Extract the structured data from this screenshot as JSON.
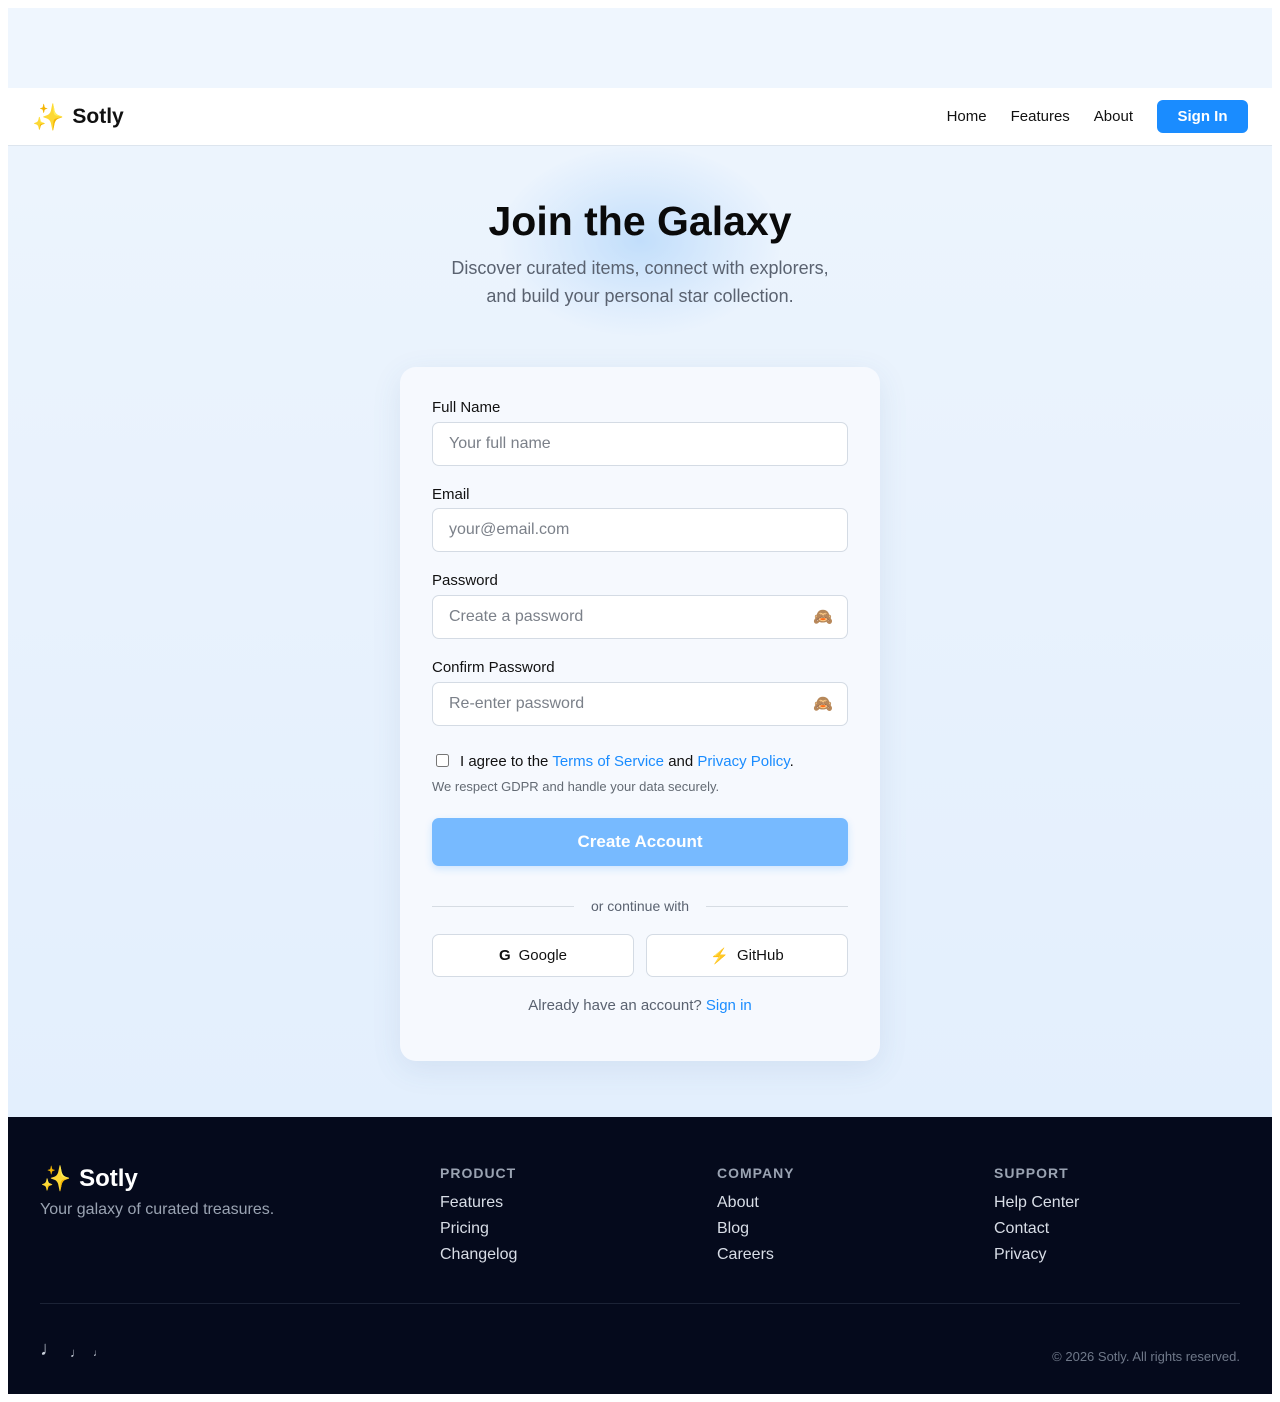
{
  "header": {
    "brand_icon": "sparkles-icon",
    "brand_icon_glyph": "✨",
    "brand_name": "Sotly",
    "nav": [
      "Home",
      "Features",
      "About"
    ],
    "signin_label": "Sign In",
    "accent_color": "#1a8cff"
  },
  "hero": {
    "title": "Join the Galaxy",
    "subtitle": "Discover curated items, connect with explorers, and build your personal star collection."
  },
  "form": {
    "full_name": {
      "label": "Full Name",
      "placeholder": "Your full name",
      "value": ""
    },
    "email": {
      "label": "Email",
      "placeholder": "your@email.com",
      "value": ""
    },
    "password": {
      "label": "Password",
      "placeholder": "Create a password",
      "value": "",
      "toggle_icon": "see-no-evil-monkey-icon",
      "toggle_glyph": "🙈"
    },
    "confirm_password": {
      "label": "Confirm Password",
      "placeholder": "Re-enter password",
      "value": "",
      "toggle_icon": "see-no-evil-monkey-icon",
      "toggle_glyph": "🙈"
    },
    "terms": {
      "checked": false,
      "prefix": "I agree to the",
      "tos_link": "Terms of Service",
      "middle": "and",
      "privacy_link": "Privacy Policy",
      "suffix": "."
    },
    "gdpr_note": "We respect GDPR and handle your data securely.",
    "submit_label": "Create Account",
    "submit_color": "#77baff",
    "divider_text": "or continue with",
    "social": {
      "google": {
        "icon": "google-icon",
        "glyph": "G",
        "label": "Google"
      },
      "github": {
        "icon": "lightning-icon",
        "glyph": "⚡",
        "label": "GitHub"
      }
    },
    "signin_prompt": "Already have an account?",
    "signin_link": "Sign in"
  },
  "footer": {
    "brand_icon_glyph": "✨",
    "brand_name": "Sotly",
    "tagline": "Your galaxy of curated treasures.",
    "columns": [
      {
        "title": "PRODUCT",
        "links": [
          "Features",
          "Pricing",
          "Changelog"
        ]
      },
      {
        "title": "COMPANY",
        "links": [
          "About",
          "Blog",
          "Careers"
        ]
      },
      {
        "title": "SUPPORT",
        "links": [
          "Help Center",
          "Contact",
          "Privacy"
        ]
      }
    ],
    "social_icons": [
      {
        "icon": "music-note-icon",
        "glyph": "♩"
      },
      {
        "icon": "music-note-small-icon",
        "glyph": "♩"
      },
      {
        "icon": "music-note-tiny-icon",
        "glyph": "♩"
      }
    ],
    "copyright": "© 2026 Sotly. All rights reserved.",
    "background_color": "#050a1c"
  }
}
